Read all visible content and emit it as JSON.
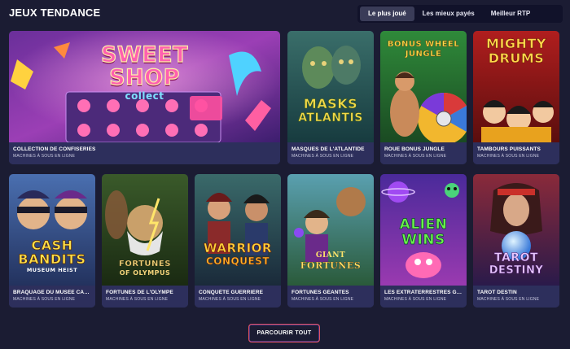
{
  "section": {
    "title": "JEUX TENDANCE"
  },
  "tabs": [
    {
      "label": "Le plus joué",
      "active": true
    },
    {
      "label": "Les mieux payés",
      "active": false
    },
    {
      "label": "Meilleur RTP",
      "active": false
    }
  ],
  "games": [
    {
      "name": "COLLECTION DE CONFISERIES",
      "category": "MACHINES À SOUS EN LIGNE",
      "logo": [
        "SWEET",
        "SHOP",
        "collect"
      ]
    },
    {
      "name": "MASQUES DE L'ATLANTIDE",
      "category": "MACHINES À SOUS EN LIGNE",
      "logo": [
        "MASKS",
        "ATLANTIS"
      ]
    },
    {
      "name": "ROUE BONUS JUNGLE",
      "category": "MACHINES À SOUS EN LIGNE",
      "logo": [
        "BONUS WHEEL",
        "JUNGLE"
      ]
    },
    {
      "name": "TAMBOURS PUISSANTS",
      "category": "MACHINES À SOUS EN LIGNE",
      "logo": [
        "MIGHTY",
        "DRUMS"
      ]
    },
    {
      "name": "BRAQUAGE DU MUSÉE CASH...",
      "category": "MACHINES À SOUS EN LIGNE",
      "logo": [
        "CASH",
        "BANDITS",
        "MUSEUM HEIST"
      ]
    },
    {
      "name": "FORTUNES DE L'OLYMPE",
      "category": "MACHINES À SOUS EN LIGNE",
      "logo": [
        "FORTUNES",
        "OF OLYMPUS"
      ]
    },
    {
      "name": "CONQUÊTE GUERRIÈRE",
      "category": "MACHINES À SOUS EN LIGNE",
      "logo": [
        "WARRIOR",
        "CONQUEST"
      ]
    },
    {
      "name": "FORTUNES GÉANTES",
      "category": "MACHINES À SOUS EN LIGNE",
      "logo": [
        "GIANT",
        "FORTUNES"
      ]
    },
    {
      "name": "LES EXTRATERRESTRES GAG...",
      "category": "MACHINES À SOUS EN LIGNE",
      "logo": [
        "ALIEN",
        "WINS"
      ]
    },
    {
      "name": "TAROT DESTIN",
      "category": "MACHINES À SOUS EN LIGNE",
      "logo": [
        "TAROT",
        "DESTINY"
      ]
    }
  ],
  "browse_button": {
    "label": "PARCOURIR TOUT"
  }
}
